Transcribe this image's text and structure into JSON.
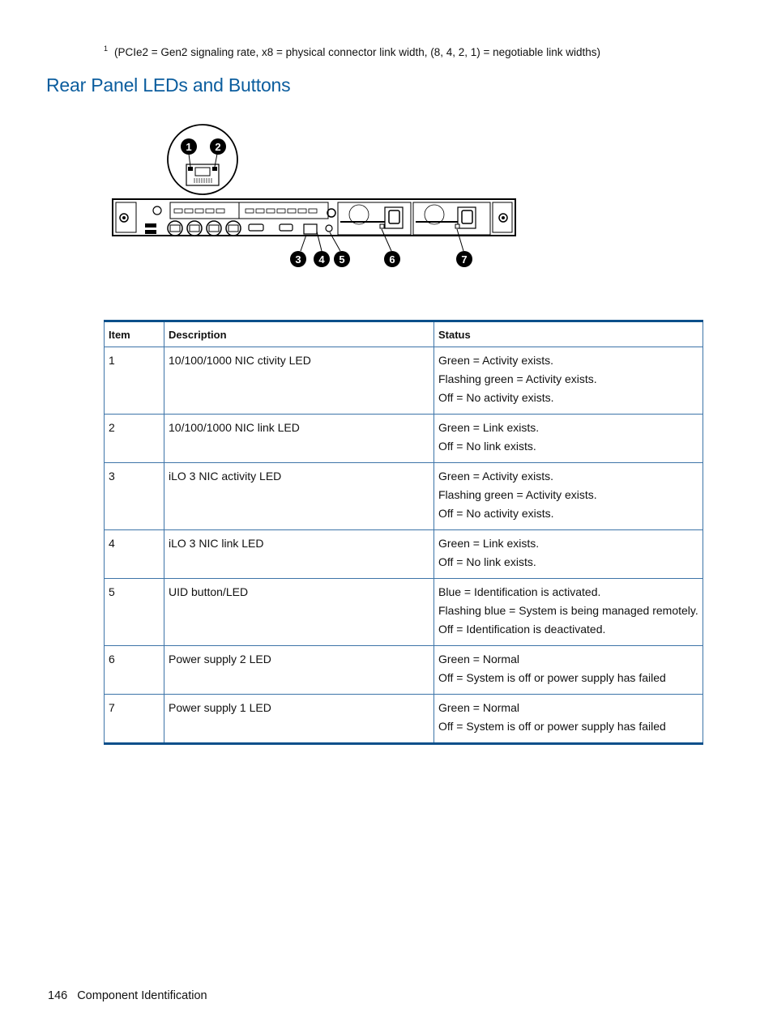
{
  "footnote": {
    "marker": "1",
    "text": "(PCIe2 = Gen2 signaling rate, x8 = physical connector link width, (8, 4, 2, 1) = negotiable link widths)"
  },
  "section": {
    "title": "Rear Panel LEDs and Buttons"
  },
  "diagram": {
    "callouts": [
      "1",
      "2",
      "3",
      "4",
      "5",
      "6",
      "7"
    ]
  },
  "table": {
    "headers": [
      "Item",
      "Description",
      "Status"
    ],
    "rows": [
      {
        "item": "1",
        "description": "10/100/1000 NIC ctivity LED",
        "status": [
          "Green = Activity exists.",
          "Flashing green = Activity exists.",
          "Off = No activity exists."
        ]
      },
      {
        "item": "2",
        "description": "10/100/1000 NIC link LED",
        "status": [
          "Green = Link exists.",
          "Off = No link exists."
        ]
      },
      {
        "item": "3",
        "description": "iLO 3 NIC activity LED",
        "status": [
          "Green = Activity exists.",
          "Flashing green = Activity exists.",
          "Off = No activity exists."
        ]
      },
      {
        "item": "4",
        "description": "iLO 3 NIC link LED",
        "status": [
          "Green = Link exists.",
          "Off = No link exists."
        ]
      },
      {
        "item": "5",
        "description": "UID button/LED",
        "status": [
          "Blue = Identification is activated.",
          "Flashing blue = System is being managed remotely.",
          "Off = Identification is deactivated."
        ]
      },
      {
        "item": "6",
        "description": "Power supply 2 LED",
        "status": [
          "Green = Normal",
          "Off = System is off or power supply has failed"
        ]
      },
      {
        "item": "7",
        "description": "Power supply 1 LED",
        "status": [
          "Green = Normal",
          "Off = System is off or power supply has failed"
        ]
      }
    ]
  },
  "footer": {
    "page_number": "146",
    "chapter": "Component Identification"
  }
}
